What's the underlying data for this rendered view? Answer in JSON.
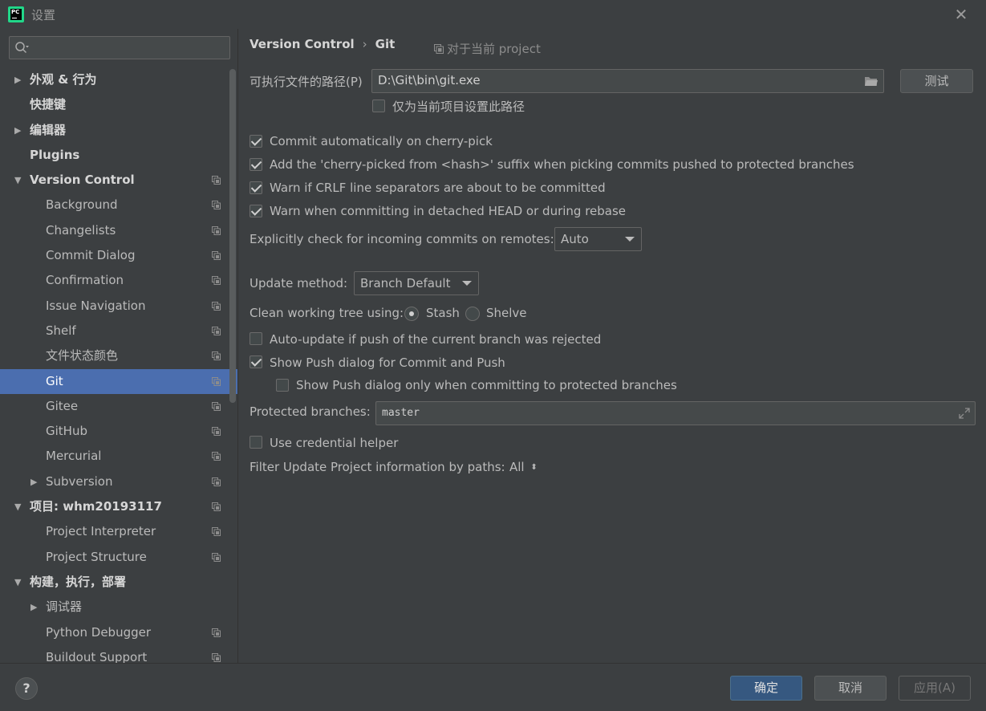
{
  "window": {
    "title": "设置",
    "logo_text": "PC"
  },
  "search": {
    "placeholder": ""
  },
  "sidebar": {
    "items": [
      {
        "label": "外观 & 行为",
        "level": 0,
        "arrow": "right"
      },
      {
        "label": "快捷键",
        "level": 0
      },
      {
        "label": "编辑器",
        "level": 0,
        "arrow": "right"
      },
      {
        "label": "Plugins",
        "level": 0
      },
      {
        "label": "Version Control",
        "level": 0,
        "arrow": "down",
        "icon": true
      },
      {
        "label": "Background",
        "level": 1,
        "icon": true
      },
      {
        "label": "Changelists",
        "level": 1,
        "icon": true
      },
      {
        "label": "Commit Dialog",
        "level": 1,
        "icon": true
      },
      {
        "label": "Confirmation",
        "level": 1,
        "icon": true
      },
      {
        "label": "Issue Navigation",
        "level": 1,
        "icon": true
      },
      {
        "label": "Shelf",
        "level": 1,
        "icon": true
      },
      {
        "label": "文件状态颜色",
        "level": 1,
        "icon": true
      },
      {
        "label": "Git",
        "level": 1,
        "icon": true,
        "selected": true
      },
      {
        "label": "Gitee",
        "level": 1,
        "icon": true
      },
      {
        "label": "GitHub",
        "level": 1,
        "icon": true
      },
      {
        "label": "Mercurial",
        "level": 1,
        "icon": true
      },
      {
        "label": "Subversion",
        "level": 1,
        "arrow": "right",
        "icon": true
      },
      {
        "label": "项目: whm20193117",
        "level": 0,
        "arrow": "down",
        "icon": true
      },
      {
        "label": "Project Interpreter",
        "level": 1,
        "icon": true
      },
      {
        "label": "Project Structure",
        "level": 1,
        "icon": true
      },
      {
        "label": "构建，执行，部署",
        "level": 0,
        "arrow": "down"
      },
      {
        "label": "调试器",
        "level": 1,
        "arrow": "right"
      },
      {
        "label": "Python Debugger",
        "level": 1,
        "icon": true
      },
      {
        "label": "Buildout Support",
        "level": 1,
        "icon": true
      }
    ]
  },
  "main": {
    "breadcrumb": {
      "parent": "Version Control",
      "current": "Git",
      "separator": "›"
    },
    "scope_note": "对于当前 project",
    "exe_path": {
      "label": "可执行文件的路径(P)",
      "value": "D:\\Git\\bin\\git.exe",
      "test_button": "测试"
    },
    "project_only": {
      "label": "仅为当前项目设置此路径",
      "checked": false
    },
    "checks": [
      {
        "label": "Commit automatically on cherry-pick",
        "checked": true
      },
      {
        "label": "Add the 'cherry-picked from <hash>' suffix when picking commits pushed to protected branches",
        "checked": true
      },
      {
        "label": "Warn if CRLF line separators are about to be committed",
        "checked": true
      },
      {
        "label": "Warn when committing in detached HEAD or during rebase",
        "checked": true
      }
    ],
    "incoming": {
      "label": "Explicitly check for incoming commits on remotes:",
      "value": "Auto"
    },
    "update_method": {
      "label": "Update method:",
      "value": "Branch Default"
    },
    "clean_tree": {
      "label": "Clean working tree using:",
      "options": [
        "Stash",
        "Shelve"
      ],
      "selected": "Stash"
    },
    "auto_update": {
      "label": "Auto-update if push of the current branch was rejected",
      "checked": false
    },
    "show_push": {
      "label": "Show Push dialog for Commit and Push",
      "checked": true
    },
    "show_push_protected": {
      "label": "Show Push dialog only when committing to protected branches",
      "checked": false
    },
    "protected": {
      "label": "Protected branches:",
      "value": "master"
    },
    "credential": {
      "label": "Use credential helper",
      "checked": false
    },
    "filter": {
      "label": "Filter Update Project information by paths:",
      "value": "All"
    }
  },
  "footer": {
    "help": "?",
    "ok": "确定",
    "cancel": "取消",
    "apply": "应用(A)"
  }
}
